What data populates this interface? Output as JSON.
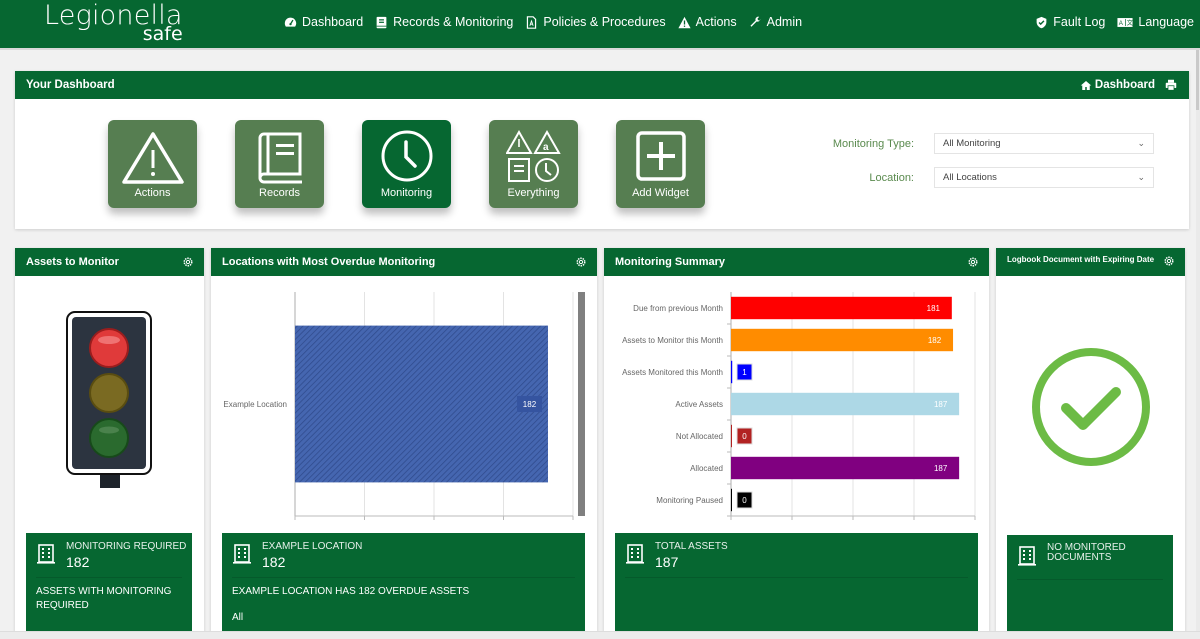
{
  "app": {
    "logo_main": "Legionella",
    "logo_sub": "safe"
  },
  "nav": {
    "items": [
      {
        "label": "Dashboard",
        "icon": "tachometer-icon"
      },
      {
        "label": "Records & Monitoring",
        "icon": "book-icon"
      },
      {
        "label": "Policies & Procedures",
        "icon": "pdf-file-icon"
      },
      {
        "label": "Actions",
        "icon": "warning-icon"
      },
      {
        "label": "Admin",
        "icon": "wrench-icon"
      }
    ],
    "right": [
      {
        "label": "Fault Log",
        "icon": "shield-check-icon"
      },
      {
        "label": "Language",
        "icon": "language-icon"
      }
    ]
  },
  "dashboard": {
    "title": "Your Dashboard",
    "home_label": "Dashboard",
    "tiles": [
      {
        "label": "Actions",
        "icon": "warning-icon"
      },
      {
        "label": "Records",
        "icon": "book-icon"
      },
      {
        "label": "Monitoring",
        "icon": "clock-icon",
        "active": true
      },
      {
        "label": "Everything",
        "icon": "everything-icon"
      },
      {
        "label": "Add Widget",
        "icon": "plus-square-icon"
      }
    ],
    "filters": {
      "monitoring_type_label": "Monitoring Type:",
      "monitoring_type_value": "All Monitoring",
      "location_label": "Location:",
      "location_value": "All Locations"
    }
  },
  "widgets": {
    "assets": {
      "title": "Assets to Monitor",
      "stat_label": "MONITORING REQUIRED",
      "stat_value": "182",
      "desc": "ASSETS WITH MONITORING REQUIRED"
    },
    "overdue": {
      "title": "Locations with Most Overdue Monitoring",
      "stat_label": "EXAMPLE LOCATION",
      "stat_value": "182",
      "desc": "EXAMPLE LOCATION HAS 182 OVERDUE ASSETS",
      "sub": "All"
    },
    "summary": {
      "title": "Monitoring Summary",
      "stat_label": "TOTAL ASSETS",
      "stat_value": "187"
    },
    "logbook": {
      "title": "Logbook Document with Expiring Date",
      "stat_label": "NO MONITORED DOCUMENTS"
    }
  },
  "chart_data": [
    {
      "type": "bar",
      "orientation": "horizontal",
      "title": "Locations with Most Overdue Monitoring",
      "categories": [
        "Example Location"
      ],
      "values": [
        182
      ],
      "colors": [
        "#3f5fa8"
      ],
      "xlim": [
        0,
        200
      ],
      "grid": true
    },
    {
      "type": "bar",
      "orientation": "horizontal",
      "title": "Monitoring Summary",
      "categories": [
        "Due from previous Month",
        "Assets to Monitor this Month",
        "Assets Monitored this Month",
        "Active Assets",
        "Not Allocated",
        "Allocated",
        "Monitoring Paused"
      ],
      "values": [
        181,
        182,
        1,
        187,
        0,
        187,
        0
      ],
      "colors": [
        "#ff0000",
        "#ff8c00",
        "#0000ff",
        "#add8e6",
        "#b22222",
        "#800080",
        "#000000"
      ],
      "xlim": [
        0,
        200
      ],
      "grid": true
    }
  ]
}
